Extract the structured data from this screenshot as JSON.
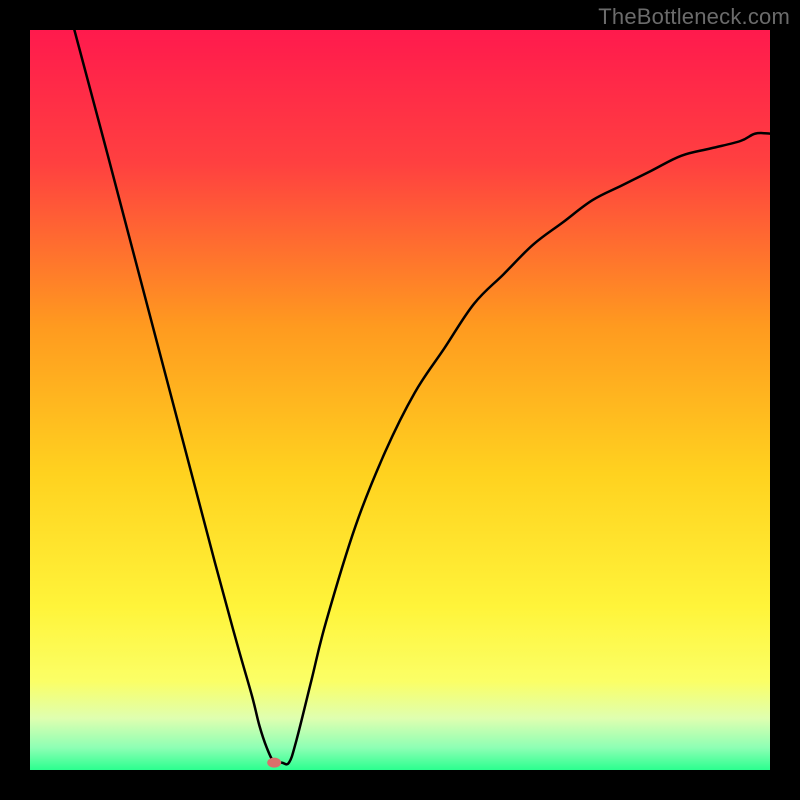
{
  "watermark": "TheBottleneck.com",
  "chart_data": {
    "type": "line",
    "title": "",
    "xlabel": "",
    "ylabel": "",
    "xlim": [
      0,
      100
    ],
    "ylim": [
      0,
      100
    ],
    "grid": false,
    "legend": false,
    "series": [
      {
        "name": "curve",
        "x": [
          6,
          10,
          15,
          20,
          25,
          28,
          30,
          31,
          32,
          33,
          34,
          35,
          36,
          38,
          40,
          44,
          48,
          52,
          56,
          60,
          64,
          68,
          72,
          76,
          80,
          84,
          88,
          92,
          96,
          98,
          100
        ],
        "values": [
          100,
          85,
          66,
          47,
          28,
          17,
          10,
          6,
          3,
          1,
          1,
          1,
          4,
          12,
          20,
          33,
          43,
          51,
          57,
          63,
          67,
          71,
          74,
          77,
          79,
          81,
          83,
          84,
          85,
          86,
          86
        ]
      }
    ],
    "marker": {
      "x": 33,
      "y": 1,
      "color": "#d9706b"
    },
    "gradient_stops": [
      {
        "offset": 0.0,
        "color": "#ff1a4d"
      },
      {
        "offset": 0.18,
        "color": "#ff4040"
      },
      {
        "offset": 0.4,
        "color": "#ff9a1f"
      },
      {
        "offset": 0.6,
        "color": "#ffd21f"
      },
      {
        "offset": 0.78,
        "color": "#fff43a"
      },
      {
        "offset": 0.88,
        "color": "#fbff66"
      },
      {
        "offset": 0.93,
        "color": "#dfffb0"
      },
      {
        "offset": 0.97,
        "color": "#8dffb4"
      },
      {
        "offset": 1.0,
        "color": "#2bff8f"
      }
    ],
    "colors": {
      "background": "#000000",
      "curve": "#000000",
      "marker": "#d9706b"
    }
  }
}
